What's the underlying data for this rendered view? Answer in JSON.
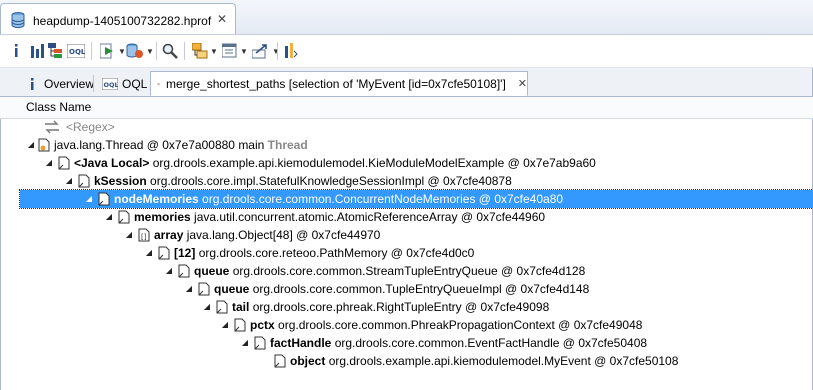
{
  "editor_tab": {
    "label": "heapdump-1405100732282.hprof"
  },
  "toolbar": {
    "icons": [
      "info-icon",
      "histogram-icon",
      "dominator-tree-icon",
      "oql-icon",
      "run-report-icon",
      "query-browser-icon",
      "search-icon",
      "group-by-icon",
      "calculate-retained-icon",
      "export-icon",
      "pin-icon"
    ]
  },
  "tabs": [
    {
      "label": "Overview"
    },
    {
      "label": "OQL"
    },
    {
      "label": "merge_shortest_paths [selection of 'MyEvent [id=0x7cfe50108]']"
    }
  ],
  "column": {
    "class_name": "Class Name"
  },
  "tree": [
    {
      "name": "",
      "desc": "<Regex>",
      "type": "regex"
    },
    {
      "name": "",
      "desc": "java.lang.Thread @ 0x7e7a00880  main",
      "suffix": "Thread",
      "type": "thread"
    },
    {
      "name": "<Java Local>",
      "desc": "org.drools.example.api.kiemodulemodel.KieModuleModelExample @ 0x7e7ab9a60"
    },
    {
      "name": "kSession",
      "desc": "org.drools.core.impl.StatefulKnowledgeSessionImpl @ 0x7cfe40878"
    },
    {
      "name": "nodeMemories",
      "desc": "org.drools.core.common.ConcurrentNodeMemories @ 0x7cfe40a80"
    },
    {
      "name": "memories",
      "desc": "java.util.concurrent.atomic.AtomicReferenceArray @ 0x7cfe44960"
    },
    {
      "name": "array",
      "desc": "java.lang.Object[48] @ 0x7cfe44970",
      "type": "array"
    },
    {
      "name": "[12]",
      "desc": "org.drools.core.reteoo.PathMemory @ 0x7cfe4d0c0"
    },
    {
      "name": "queue",
      "desc": "org.drools.core.common.StreamTupleEntryQueue @ 0x7cfe4d128"
    },
    {
      "name": "queue",
      "desc": "org.drools.core.common.TupleEntryQueueImpl @ 0x7cfe4d148"
    },
    {
      "name": "tail",
      "desc": "org.drools.core.phreak.RightTupleEntry @ 0x7cfe49098"
    },
    {
      "name": "pctx",
      "desc": "org.drools.core.common.PhreakPropagationContext @ 0x7cfe49048"
    },
    {
      "name": "factHandle",
      "desc": "org.drools.core.common.EventFactHandle @ 0x7cfe50408"
    },
    {
      "name": "object",
      "desc": "org.drools.example.api.kiemodulemodel.MyEvent @ 0x7cfe50108"
    }
  ],
  "selected_row": 4,
  "colors": {
    "selection": "#3399ff",
    "tab_border": "#a9b9cf"
  }
}
